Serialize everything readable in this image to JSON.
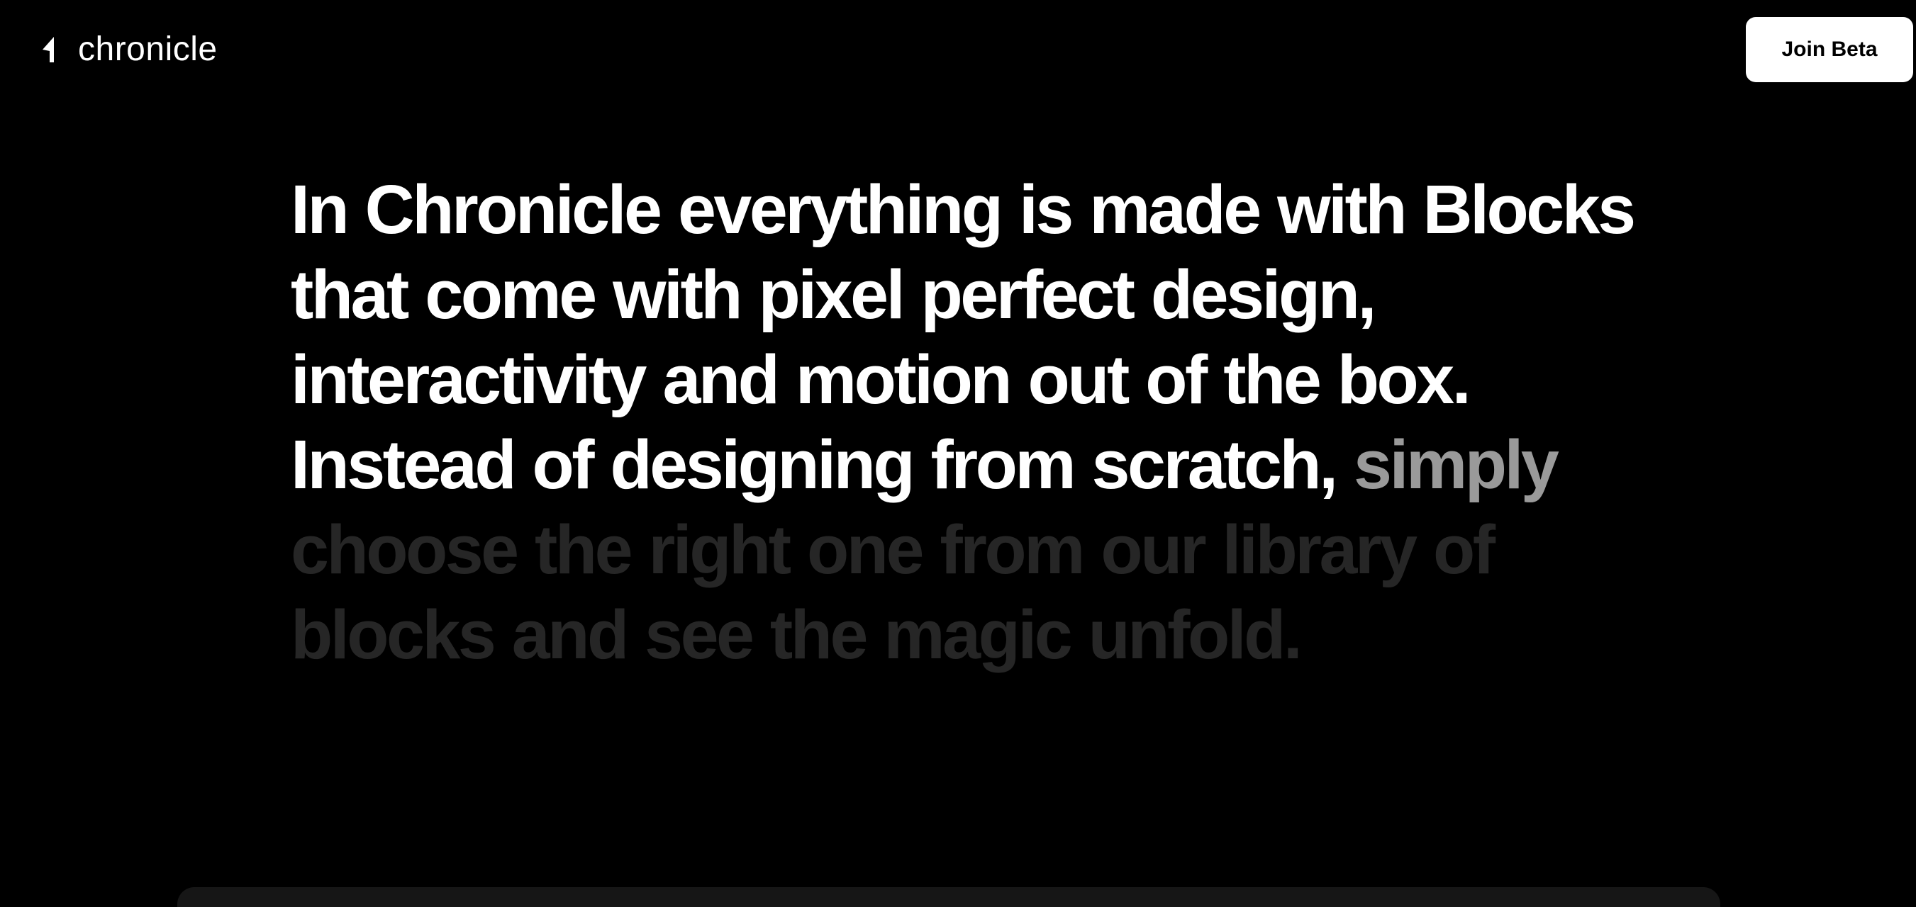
{
  "nav": {
    "brand_name": "chronicle",
    "brand_icon": "chronicle-logo-icon",
    "cta_label": "Join Beta"
  },
  "hero": {
    "text_bright": "In Chronicle everything is made with Blocks that come with pixel perfect design, interactivity and motion out of the box. Instead of designing from scratch, ",
    "text_highlight": "simply",
    "text_faded": " choose the right one from our library of blocks and see the magic unfold."
  },
  "colors": {
    "background": "#000000",
    "text_bright": "#ffffff",
    "text_highlight": "#9a9a9a",
    "text_faded": "#262626",
    "button_bg": "#ffffff",
    "button_text": "#000000",
    "panel_bg": "#161616"
  }
}
